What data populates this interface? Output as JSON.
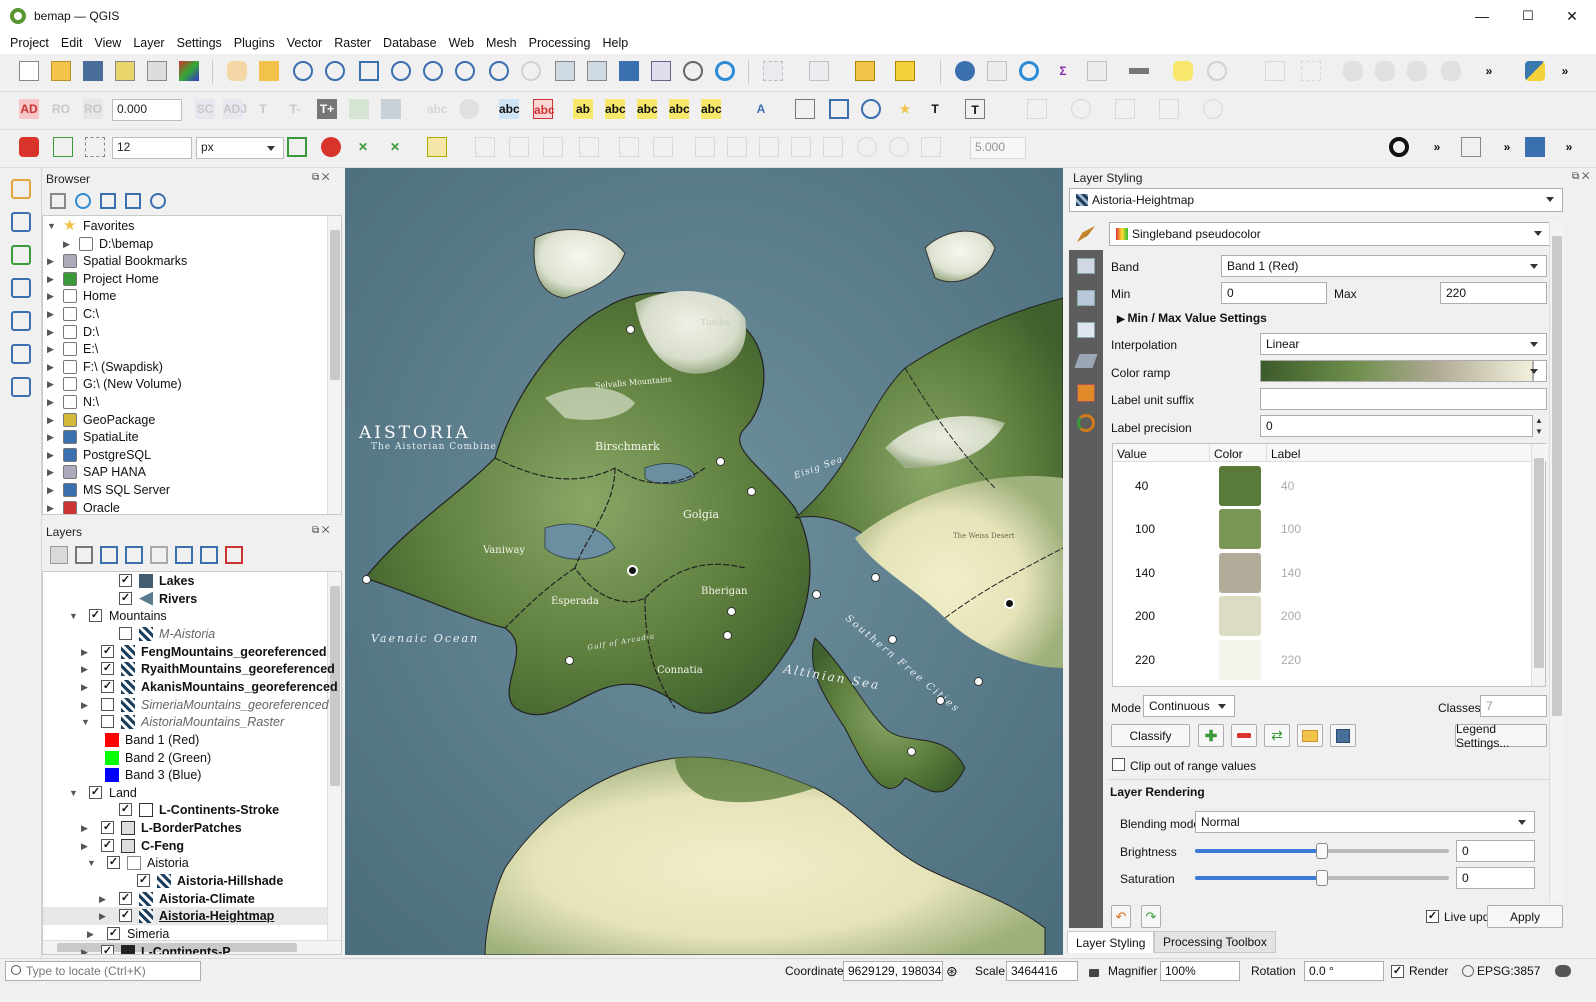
{
  "window": {
    "title": "bemap — QGIS",
    "minimize": "—",
    "maximize": "☐",
    "close": "✕"
  },
  "menu": [
    "Project",
    "Edit",
    "View",
    "Layer",
    "Settings",
    "Plugins",
    "Vector",
    "Raster",
    "Database",
    "Web",
    "Mesh",
    "Processing",
    "Help"
  ],
  "toolbar": {
    "label_offset": "0.000",
    "snap_tolerance": "12",
    "snap_units": "px",
    "tolerance_value": "5.000",
    "overflow": "»"
  },
  "browser": {
    "title": "Browser",
    "items": [
      {
        "label": "Favorites",
        "icon": "star-icon",
        "expanded": true,
        "indent": 0
      },
      {
        "label": "D:\\bemap",
        "icon": "folder-icon",
        "expanded": false,
        "indent": 1
      },
      {
        "label": "Spatial Bookmarks",
        "icon": "bookmark-icon",
        "indent": 0
      },
      {
        "label": "Project Home",
        "icon": "project-home-icon",
        "indent": 0
      },
      {
        "label": "Home",
        "icon": "home-icon",
        "indent": 0
      },
      {
        "label": "C:\\",
        "icon": "folder-icon",
        "indent": 0
      },
      {
        "label": "D:\\",
        "icon": "folder-icon",
        "indent": 0
      },
      {
        "label": "E:\\",
        "icon": "folder-icon",
        "indent": 0
      },
      {
        "label": "F:\\ (Swapdisk)",
        "icon": "folder-icon",
        "indent": 0
      },
      {
        "label": "G:\\ (New Volume)",
        "icon": "folder-icon",
        "indent": 0
      },
      {
        "label": "N:\\",
        "icon": "folder-icon",
        "indent": 0
      },
      {
        "label": "GeoPackage",
        "icon": "geopackage-icon",
        "indent": 0
      },
      {
        "label": "SpatiaLite",
        "icon": "spatialite-icon",
        "indent": 0
      },
      {
        "label": "PostgreSQL",
        "icon": "postgresql-icon",
        "indent": 0
      },
      {
        "label": "SAP HANA",
        "icon": "saphana-icon",
        "indent": 0
      },
      {
        "label": "MS SQL Server",
        "icon": "mssql-icon",
        "indent": 0
      },
      {
        "label": "Oracle",
        "icon": "oracle-icon",
        "indent": 0
      }
    ]
  },
  "layers": {
    "title": "Layers",
    "items": [
      {
        "label": "Lakes",
        "bold": true,
        "checked": true,
        "indent": 3,
        "icon": "polygon-fill"
      },
      {
        "label": "Rivers",
        "bold": true,
        "checked": true,
        "indent": 3,
        "icon": "line"
      },
      {
        "label": "Mountains",
        "bold": false,
        "checked": true,
        "indent": 1,
        "group": true,
        "expanded": true
      },
      {
        "label": "M-Aistoria",
        "italic": true,
        "checked": false,
        "indent": 3,
        "icon": "raster"
      },
      {
        "label": "FengMountains_georeferenced",
        "bold": true,
        "checked": true,
        "indent": 2,
        "icon": "raster",
        "expander": true
      },
      {
        "label": "RyaithMountains_georeferenced",
        "bold": true,
        "checked": true,
        "indent": 2,
        "icon": "raster",
        "expander": true
      },
      {
        "label": "AkanisMountains_georeferenced",
        "bold": true,
        "checked": true,
        "indent": 2,
        "icon": "raster",
        "expander": true
      },
      {
        "label": "SimeriaMountains_georeferenced",
        "italic": true,
        "checked": false,
        "indent": 2,
        "icon": "raster",
        "expander": true
      },
      {
        "label": "AistoriaMountains_Raster",
        "italic": true,
        "checked": false,
        "indent": 2,
        "icon": "raster",
        "expanded": true
      },
      {
        "label": "Band 1 (Red)",
        "swatch": "#ff0000",
        "indent": 4
      },
      {
        "label": "Band 2 (Green)",
        "swatch": "#00ff00",
        "indent": 4
      },
      {
        "label": "Band 3 (Blue)",
        "swatch": "#0000ff",
        "indent": 4
      },
      {
        "label": "Land",
        "checked": true,
        "indent": 1,
        "group": true,
        "expanded": true
      },
      {
        "label": "L-Continents-Stroke",
        "bold": true,
        "checked": true,
        "indent": 3,
        "icon": "outline"
      },
      {
        "label": "L-BorderPatches",
        "bold": true,
        "checked": true,
        "indent": 2,
        "icon": "polygon",
        "expander": true
      },
      {
        "label": "C-Feng",
        "bold": true,
        "checked": true,
        "indent": 2,
        "icon": "polygon",
        "expander": true
      },
      {
        "label": "Aistoria",
        "checked": true,
        "indent": 2,
        "group": true,
        "expanded": true
      },
      {
        "label": "Aistoria-Hillshade",
        "bold": true,
        "checked": true,
        "indent": 4,
        "icon": "raster"
      },
      {
        "label": "Aistoria-Climate",
        "bold": true,
        "checked": true,
        "indent": 3,
        "icon": "raster",
        "expander": true
      },
      {
        "label": "Aistoria-Heightmap",
        "bold": true,
        "underline": true,
        "checked": true,
        "indent": 3,
        "icon": "raster",
        "expander": true,
        "selected": true
      },
      {
        "label": "Simeria",
        "checked": true,
        "indent": 2,
        "group": true,
        "expander": true
      },
      {
        "label": "L-Continents-P...",
        "bold": true,
        "checked": true,
        "indent": 2,
        "icon": "polygon-dark",
        "expander": true
      }
    ]
  },
  "map": {
    "title": "AISTORIA",
    "subtitle": "The Aistorian Combine",
    "ocean_labels": [
      {
        "text": "Vaenaic Ocean"
      },
      {
        "text": "Altinian Sea"
      },
      {
        "text": "Eisig Sea"
      },
      {
        "text": "Southern Free Cities"
      },
      {
        "text": "Gulf of Arcadia"
      }
    ],
    "region_labels": [
      "Birschmark",
      "Golgia",
      "Vaniway",
      "Esperada",
      "Bherigan",
      "Connatia",
      "Selvalis Mountains",
      "The Weiss Desert",
      "Tundra"
    ]
  },
  "styling": {
    "title": "Layer Styling",
    "layer": "Aistoria-Heightmap",
    "renderer": "Singleband pseudocolor",
    "band_label": "Band",
    "band": "Band 1 (Red)",
    "min_label": "Min",
    "min": "0",
    "max_label": "Max",
    "max": "220",
    "minmax_section": "Min / Max Value Settings",
    "interpolation_label": "Interpolation",
    "interpolation": "Linear",
    "color_ramp_label": "Color ramp",
    "unit_suffix_label": "Label unit suffix",
    "unit_suffix": "",
    "precision_label": "Label precision",
    "precision": "0",
    "table_headers": [
      "Value",
      "Color",
      "Label"
    ],
    "classes": [
      {
        "value": "40",
        "color": "#5a7a3a",
        "label": "40"
      },
      {
        "value": "100",
        "color": "#7a9655",
        "label": "100"
      },
      {
        "value": "140",
        "color": "#b3ab9a",
        "label": "140"
      },
      {
        "value": "200",
        "color": "#dcdcc2",
        "label": "200"
      },
      {
        "value": "220",
        "color": "#f4f4ea",
        "label": "220"
      }
    ],
    "mode_label": "Mode",
    "mode": "Continuous",
    "classes_label": "Classes",
    "classes_count": "7",
    "classify": "Classify",
    "legend_settings": "Legend Settings...",
    "clip_label": "Clip out of range values",
    "rendering_section": "Layer Rendering",
    "blending_label": "Blending mode",
    "blending": "Normal",
    "brightness_label": "Brightness",
    "brightness": "0",
    "brightness_level": 0.5,
    "saturation_label": "Saturation",
    "saturation": "0",
    "saturation_level": 0.5,
    "live_update": "Live update",
    "apply": "Apply",
    "tabs": [
      "Layer Styling",
      "Processing Toolbox"
    ]
  },
  "status": {
    "locate_placeholder": "Type to locate (Ctrl+K)",
    "coordinate_label": "Coordinate",
    "coordinate": "9629129, 198034",
    "scale_label": "Scale",
    "scale": "3464416",
    "magnifier_label": "Magnifier",
    "magnifier": "100%",
    "rotation_label": "Rotation",
    "rotation": "0.0 °",
    "render_label": "Render",
    "crs": "EPSG:3857"
  }
}
